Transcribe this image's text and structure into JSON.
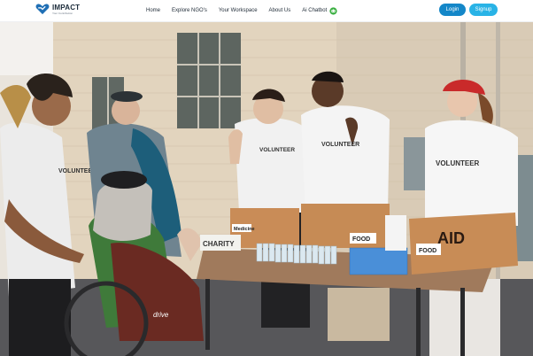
{
  "brand": {
    "name": "IMPACT",
    "tagline": "Your Contribution",
    "icon": "heart-logo-icon"
  },
  "nav": {
    "links": [
      "Home",
      "Explore NGO's",
      "Your Workspace",
      "About Us",
      "Ai Chatbot"
    ],
    "chat_icon": "chatbot-icon"
  },
  "auth": {
    "login": "Login",
    "signup": "Signup"
  },
  "colors": {
    "login": "#1487c8",
    "signup": "#29b3e6",
    "brand": "#1f6fb5"
  },
  "hero": {
    "labels": {
      "volunteer_shirt_left": "VOLUNTEER",
      "volunteer_shirt_center": "VOLUNTEER",
      "volunteer_shirt_right": "VOLUNTEER",
      "sign": "CHARITY",
      "box_medicine": "Medicine",
      "box_food": "FOOD",
      "box_aid": "AID",
      "box_aid_food": "FOOD",
      "wheelchair": "drive"
    }
  }
}
